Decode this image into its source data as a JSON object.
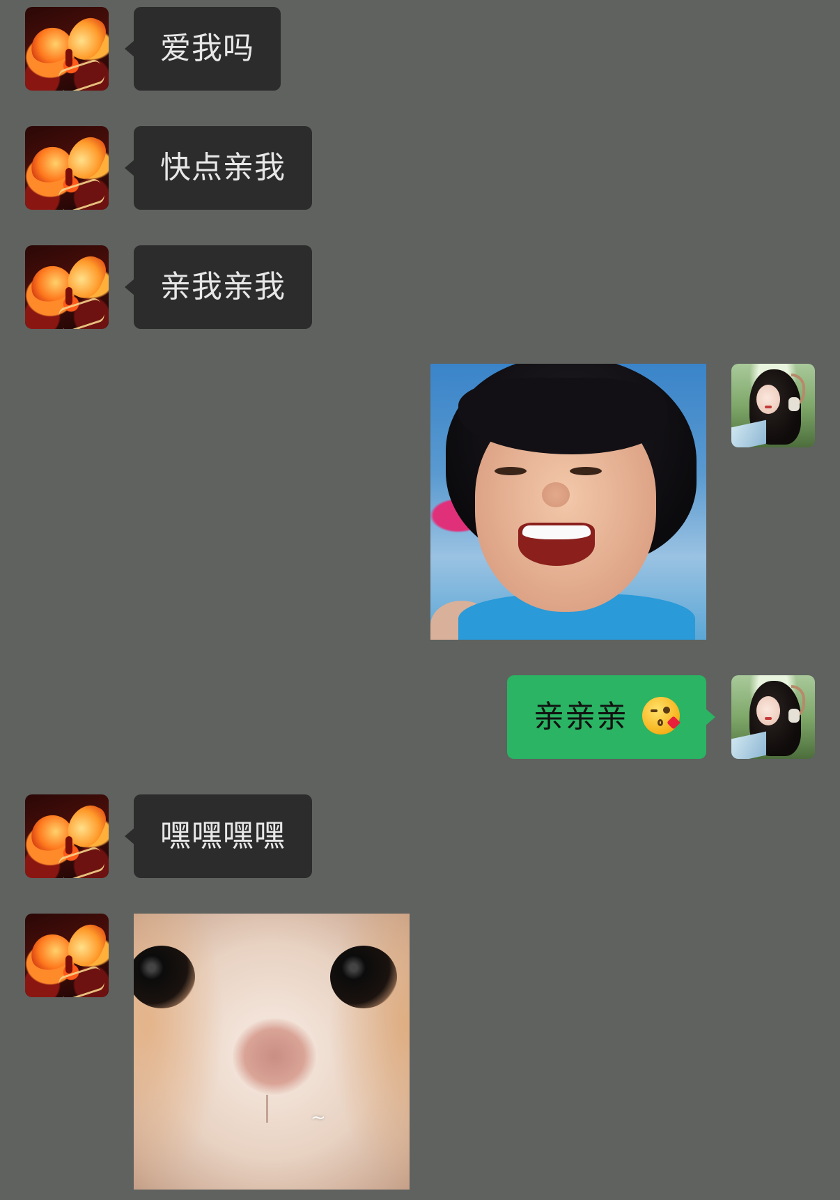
{
  "messages": [
    {
      "from": "contact",
      "type": "text",
      "text": "爱我吗"
    },
    {
      "from": "contact",
      "type": "text",
      "text": "快点亲我"
    },
    {
      "from": "contact",
      "type": "text",
      "text": "亲我亲我"
    },
    {
      "from": "self",
      "type": "sticker",
      "sticker": "laughing-woman-sticker"
    },
    {
      "from": "self",
      "type": "text",
      "text": "亲亲亲",
      "emoji": "face-blowing-kiss-emoji"
    },
    {
      "from": "contact",
      "type": "text",
      "text": "嘿嘿嘿嘿"
    },
    {
      "from": "contact",
      "type": "sticker",
      "sticker": "cat-closeup-sticker",
      "caption": "~"
    }
  ],
  "avatars": {
    "contact": "butterfly-avatar",
    "self": "girl-with-headphones-avatar"
  },
  "colors": {
    "background": "#5f625f",
    "incoming_bubble": "#2c2c2c",
    "incoming_text": "#e7e7e7",
    "outgoing_bubble": "#2ab463",
    "outgoing_text": "#111111"
  }
}
